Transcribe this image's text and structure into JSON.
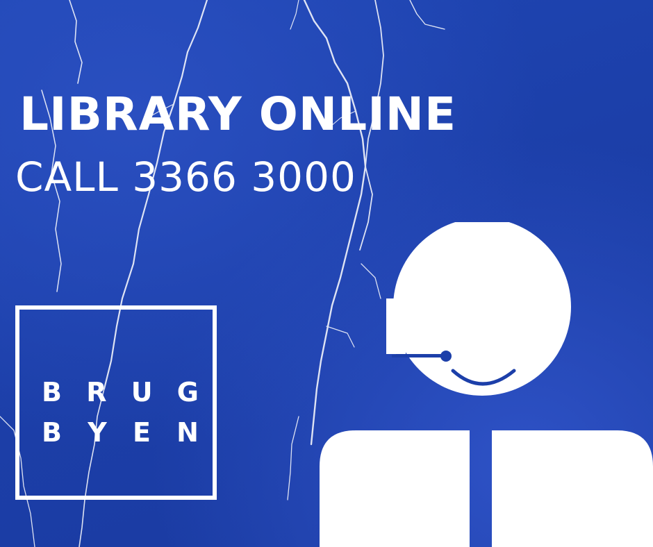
{
  "poster": {
    "headline": "LIBRARY ONLINE",
    "phone_line": "CALL 3366 3000"
  },
  "logo": {
    "line1": [
      "B",
      "R",
      "U",
      "G"
    ],
    "line2": [
      "B",
      "Y",
      "E",
      "N"
    ]
  },
  "colors": {
    "background": "#1c3fa9",
    "foreground": "#ffffff"
  },
  "icons": {
    "figure": "person-with-headset-icon"
  }
}
